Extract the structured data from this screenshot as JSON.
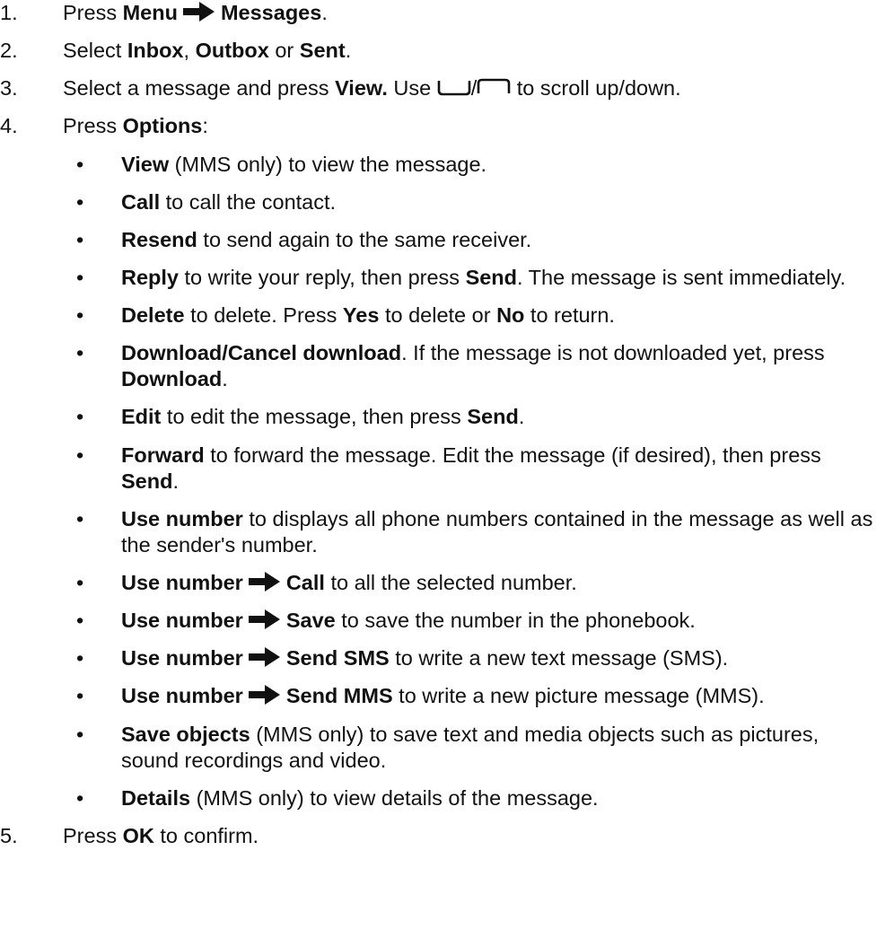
{
  "steps": {
    "s1": {
      "num": "1.",
      "pre": "Press ",
      "menu": "Menu",
      "messages": "Messages",
      "end": "."
    },
    "s2": {
      "num": "2.",
      "pre": "Select ",
      "inbox": "Inbox",
      "comma": ", ",
      "outbox": "Outbox",
      "or": " or ",
      "sent": "Sent",
      "end": "."
    },
    "s3": {
      "num": "3.",
      "pre": "Select a message and press ",
      "view": "View.",
      "use": " Use ",
      "slash": "/",
      "post": " to scroll up/down."
    },
    "s4": {
      "num": "4.",
      "pre": "Press ",
      "options": "Options",
      "end": ":"
    },
    "s5": {
      "num": "5.",
      "pre": "Press ",
      "ok": "OK",
      "post": " to confirm."
    }
  },
  "bullet_char": "•",
  "options": {
    "view": {
      "bold": "View",
      "text": " (MMS only) to view the message."
    },
    "call": {
      "bold": "Call",
      "text": " to call the contact."
    },
    "resend": {
      "bold": "Resend",
      "text": " to send again to the same receiver."
    },
    "reply": {
      "bold": "Reply",
      "text1": " to write your reply, then press ",
      "bold2": "Send",
      "text2": ". The message is sent immediately."
    },
    "delete": {
      "bold": "Delete",
      "text1": " to delete. Press ",
      "yes": "Yes",
      "text2": " to delete or ",
      "no": "No",
      "text3": " to return."
    },
    "download": {
      "bold": "Download",
      "slash": "/",
      "bold2": "Cancel download",
      "text1": ". If the message is not downloaded yet, press ",
      "bold3": "Download",
      "text2": "."
    },
    "edit": {
      "bold": "Edit",
      "text1": " to edit the message, then press ",
      "bold2": "Send",
      "text2": "."
    },
    "forward": {
      "bold": "Forward",
      "text1": " to forward the message. Edit the message (if desired), then press ",
      "bold2": "Send",
      "text2": "."
    },
    "use_number": {
      "bold": "Use number",
      "text": " to displays all phone numbers contained in the message as well as the sender's number."
    },
    "use_call": {
      "bold": "Use number",
      "bold2": "Call",
      "text": " to all the selected number."
    },
    "use_save": {
      "bold": "Use number",
      "bold2": "Save",
      "text": " to save the number in the phonebook."
    },
    "use_sms": {
      "bold": "Use number",
      "bold2": "Send SMS",
      "text": " to write a new text message (SMS)."
    },
    "use_mms": {
      "bold": "Use number",
      "bold2": "Send MMS",
      "text": " to write a new picture message (MMS)."
    },
    "save_objects": {
      "bold": "Save objects",
      "text": " (MMS only) to save text and media objects such as pictures, sound recordings and video."
    },
    "details": {
      "bold": "Details",
      "text": " (MMS only) to view details of the message."
    }
  },
  "icons": {
    "arrow": "right-arrow-icon",
    "key_down": "scroll-down-key-icon",
    "key_up": "scroll-up-key-icon"
  }
}
